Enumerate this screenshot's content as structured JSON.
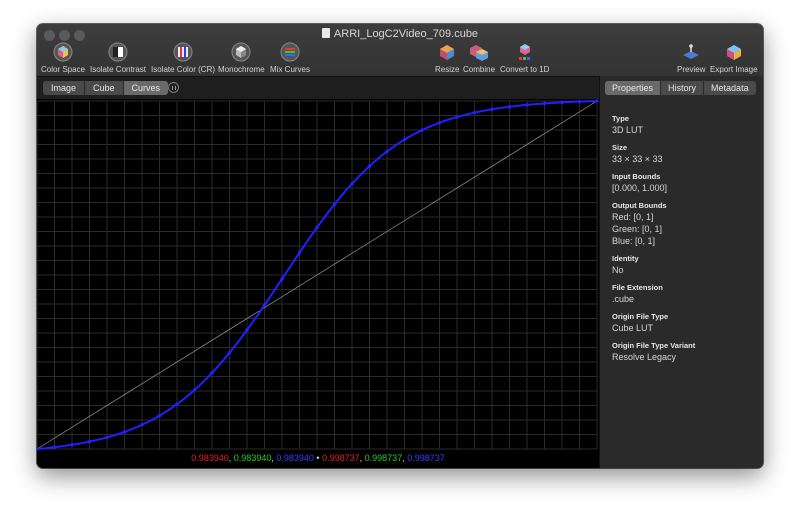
{
  "window": {
    "title": "ARRI_LogC2Video_709.cube"
  },
  "toolbar": {
    "left": [
      {
        "label": "Color Space",
        "icon": "color-space-icon"
      },
      {
        "label": "Isolate Contrast",
        "icon": "isolate-contrast-icon"
      },
      {
        "label": "Isolate Color (CR)",
        "icon": "isolate-color-icon"
      },
      {
        "label": "Monochrome",
        "icon": "monochrome-icon"
      },
      {
        "label": "Mix Curves",
        "icon": "mix-curves-icon"
      }
    ],
    "middle": [
      {
        "label": "Resize",
        "icon": "resize-icon"
      },
      {
        "label": "Combine",
        "icon": "combine-icon"
      },
      {
        "label": "Convert to 1D",
        "icon": "convert-1d-icon"
      }
    ],
    "right": [
      {
        "label": "Preview",
        "icon": "preview-icon"
      },
      {
        "label": "Export Image",
        "icon": "export-image-icon"
      }
    ]
  },
  "view_tabs": {
    "items": [
      "Image",
      "Cube",
      "Curves"
    ],
    "selected": "Curves"
  },
  "panel_tabs": {
    "items": [
      "Properties",
      "History",
      "Metadata"
    ],
    "selected": "Properties"
  },
  "properties": [
    {
      "label": "Type",
      "value": "3D LUT"
    },
    {
      "label": "Size",
      "value": "33 × 33 × 33"
    },
    {
      "label": "Input Bounds",
      "value": "[0.000, 1.000]"
    },
    {
      "label": "Output Bounds",
      "value": "Red: [0, 1]\nGreen: [0, 1]\nBlue: [0, 1]"
    },
    {
      "label": "Identity",
      "value": "No"
    },
    {
      "label": "File Extension",
      "value": ".cube"
    },
    {
      "label": "Origin File Type",
      "value": "Cube LUT"
    },
    {
      "label": "Origin File Type Variant",
      "value": "Resolve Legacy"
    }
  ],
  "readout": {
    "in_r": "0.983940",
    "in_g": "0.983940",
    "in_b": "0.983940",
    "sep": "•",
    "out_r": "0.998737",
    "out_g": "0.998737",
    "out_b": "0.998737"
  },
  "colors": {
    "red": "#e02020",
    "green": "#20d020",
    "blue": "#3a3aff",
    "curve": "#2020ff"
  },
  "curve": {
    "samples": 33,
    "xlim": [
      0,
      1
    ],
    "ylim": [
      0,
      1
    ]
  }
}
